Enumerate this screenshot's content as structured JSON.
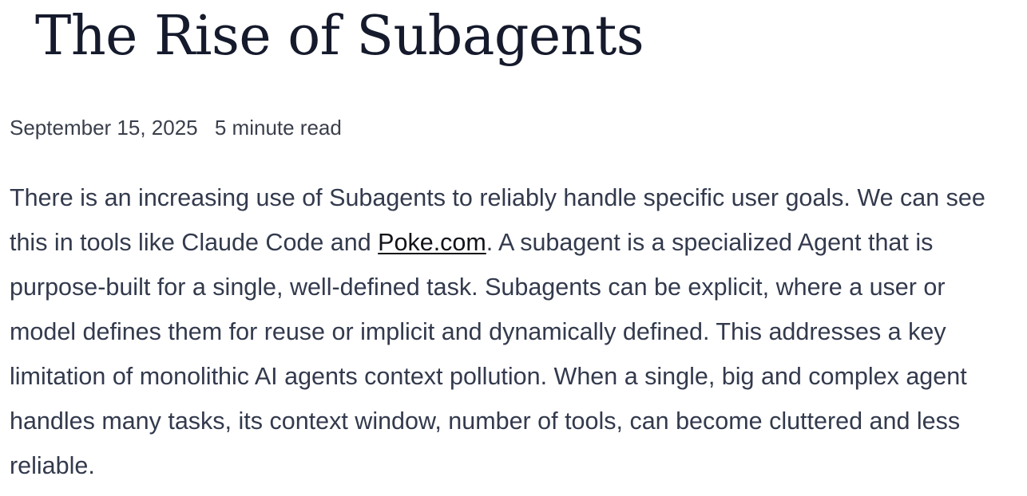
{
  "article": {
    "title": "The Rise of Subagents",
    "date": "September 15, 2025",
    "read_time": "5 minute read",
    "paragraph": {
      "before_link": "There is an increasing use of Subagents to reliably handle specific user goals. We can see this in tools like Claude Code and ",
      "link_text": "Poke.com",
      "after_link": ". A subagent is a specialized Agent that is purpose-built for a single, well-defined task. Subagents can be explicit, where a user or model defines them for reuse or implicit and dynamically defined. This addresses a key limitation of monolithic AI agents context pollution. When a single, big and complex agent handles many tasks, its context window, number of tools, can become cluttered and less reliable."
    }
  }
}
